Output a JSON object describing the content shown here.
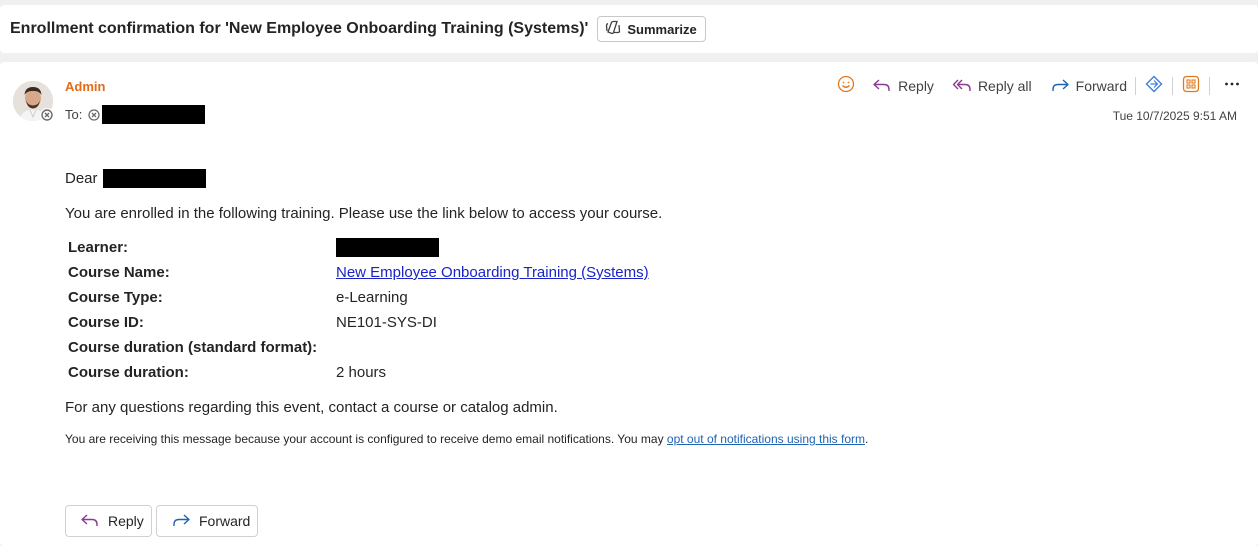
{
  "subject": {
    "text": "Enrollment confirmation for 'New Employee Onboarding Training (Systems)'",
    "summarize_label": "Summarize"
  },
  "header": {
    "sender": "Admin",
    "to_label": "To:",
    "timestamp": "Tue 10/7/2025 9:51 AM",
    "actions": {
      "reply": "Reply",
      "reply_all": "Reply all",
      "forward": "Forward"
    }
  },
  "body": {
    "greeting": "Dear",
    "intro": "You are enrolled in the following training. Please use the link below to access your course.",
    "details": [
      {
        "label": "Learner:",
        "value": ""
      },
      {
        "label": "Course Name:",
        "value": "New Employee Onboarding Training (Systems)"
      },
      {
        "label": "Course Type:",
        "value": "e-Learning"
      },
      {
        "label": "Course ID:",
        "value": "NE101-SYS-DI"
      },
      {
        "label": "Course duration (standard format):",
        "value": ""
      },
      {
        "label": "Course duration:",
        "value": "2 hours"
      }
    ],
    "questions": "For any questions regarding this event, contact a course or catalog admin.",
    "footnote_prefix": "You are receiving this message because your account is configured to receive demo email notifications. You may ",
    "footnote_link": "opt out of notifications using this form",
    "footnote_suffix": "."
  },
  "footer_buttons": {
    "reply": "Reply",
    "forward": "Forward"
  },
  "colors": {
    "sender": "#e46a1a",
    "link": "#1a23c8",
    "reply_icon": "#8a3a8f",
    "forward_icon": "#1f64b3"
  }
}
